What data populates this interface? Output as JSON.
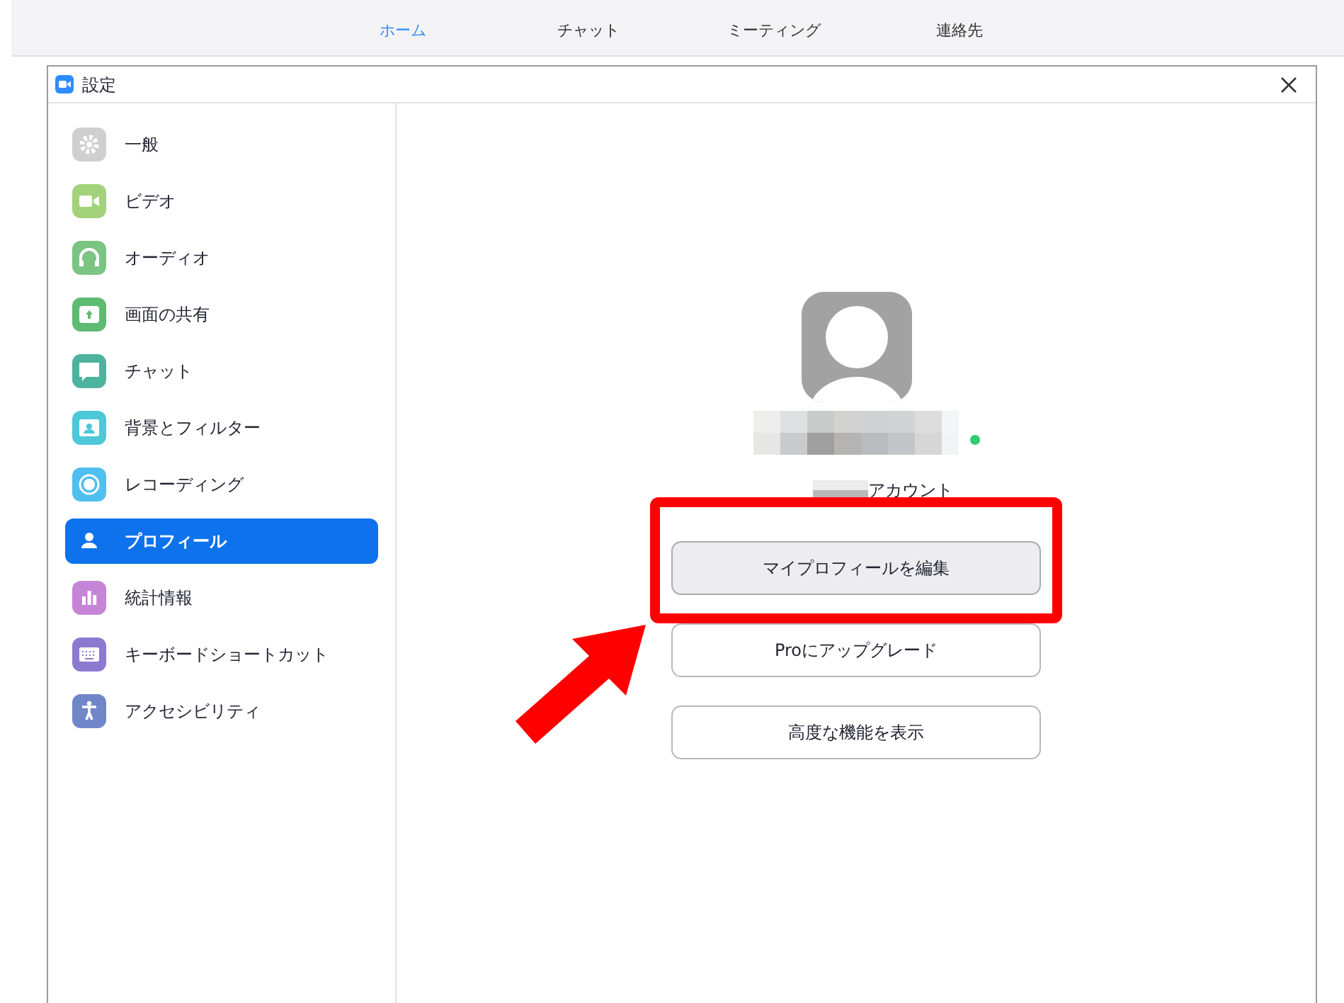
{
  "top_tabs": [
    {
      "label": "ホーム",
      "selected": true
    },
    {
      "label": "チャット",
      "selected": false
    },
    {
      "label": "ミーティング",
      "selected": false
    },
    {
      "label": "連絡先",
      "selected": false
    }
  ],
  "window": {
    "title": "設定"
  },
  "sidebar": {
    "items": [
      {
        "label": "一般",
        "kind": "gear",
        "color": "#cfcfcf",
        "selected": false
      },
      {
        "label": "ビデオ",
        "kind": "video",
        "color": "#a3d27a",
        "selected": false
      },
      {
        "label": "オーディオ",
        "kind": "headphones",
        "color": "#7cc483",
        "selected": false
      },
      {
        "label": "画面の共有",
        "kind": "share",
        "color": "#5fba72",
        "selected": false
      },
      {
        "label": "チャット",
        "kind": "chat",
        "color": "#4db39e",
        "selected": false
      },
      {
        "label": "背景とフィルター",
        "kind": "background",
        "color": "#4cc8d9",
        "selected": false
      },
      {
        "label": "レコーディング",
        "kind": "record",
        "color": "#4fbff0",
        "selected": false
      },
      {
        "label": "プロフィール",
        "kind": "person",
        "color": "#0e72ed",
        "selected": true
      },
      {
        "label": "統計情報",
        "kind": "chart",
        "color": "#c585d6",
        "selected": false
      },
      {
        "label": "キーボードショートカット",
        "kind": "keyboard",
        "color": "#8c7ad1",
        "selected": false
      },
      {
        "label": "アクセシビリティ",
        "kind": "accessibility",
        "color": "#7185c9",
        "selected": false
      }
    ]
  },
  "profile": {
    "online": true,
    "account_label": "アカウント",
    "buttons": [
      {
        "label": "マイプロフィールを編集",
        "emphasized": true
      },
      {
        "label": "Proにアップグレード",
        "emphasized": false
      },
      {
        "label": "高度な機能を表示",
        "emphasized": false
      }
    ]
  }
}
